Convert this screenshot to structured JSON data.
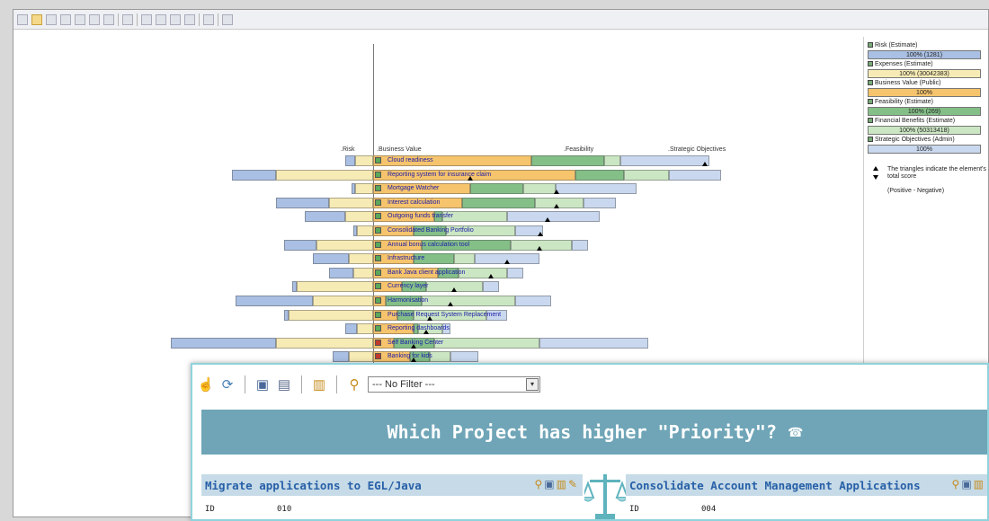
{
  "chart_columns": {
    "risk": ".Risk",
    "business_value": ".Business Value",
    "feasibility": ".Feasibility",
    "strategic": ".Strategic Objectives"
  },
  "colors": {
    "risk": "#a9bfe3",
    "expenses": "#f7ebb5",
    "business_value": "#f6c46c",
    "feasibility": "#84bf88",
    "financial_benefits": "#cbe6c3",
    "strategic": "#c9d8ee",
    "accent": "#6fa5b7"
  },
  "projects": [
    {
      "label": "Cloud readiness",
      "risk": 0.12,
      "expenses": 0.22,
      "value": 1.95,
      "feasibility": 0.9,
      "benefits": 0.2,
      "strategic": 1.1,
      "score": 4.1
    },
    {
      "label": "Reporting system for insurance claim",
      "risk": 0.55,
      "expenses": 1.2,
      "value": 2.5,
      "feasibility": 0.6,
      "benefits": 0.55,
      "strategic": 0.65,
      "score": 1.2
    },
    {
      "label": "Mortgage Watcher",
      "risk": 0.05,
      "expenses": 0.22,
      "value": 1.2,
      "feasibility": 0.65,
      "benefits": 0.4,
      "strategic": 1.0,
      "score": 2.27
    },
    {
      "label": "Interest calculation",
      "risk": 0.65,
      "expenses": 0.55,
      "value": 1.1,
      "feasibility": 0.9,
      "benefits": 0.6,
      "strategic": 0.4,
      "score": 2.27
    },
    {
      "label": "Outgoing funds transfer",
      "risk": 0.5,
      "expenses": 0.35,
      "value": 0.75,
      "feasibility": 0.1,
      "benefits": 0.8,
      "strategic": 1.15,
      "score": 2.16
    },
    {
      "label": "Consolidated Banking Portfolio",
      "risk": 0.05,
      "expenses": 0.2,
      "value": 0.5,
      "feasibility": 0.4,
      "benefits": 0.85,
      "strategic": 0.35,
      "score": 2.07
    },
    {
      "label": "Annual bonus calculation tool",
      "risk": 0.4,
      "expenses": 0.7,
      "value": 0.6,
      "feasibility": 1.1,
      "benefits": 0.75,
      "strategic": 0.2,
      "score": 2.05
    },
    {
      "label": "Infrastructure",
      "risk": 0.45,
      "expenses": 0.3,
      "value": 0.5,
      "feasibility": 0.5,
      "benefits": 0.25,
      "strategic": 0.8,
      "score": 1.65
    },
    {
      "label": "Bank Java client application",
      "risk": 0.3,
      "expenses": 0.25,
      "value": 0.8,
      "feasibility": 0.25,
      "benefits": 0.6,
      "strategic": 0.2,
      "score": 1.45
    },
    {
      "label": "Currency layer",
      "risk": 0.05,
      "expenses": 0.95,
      "value": 0.35,
      "feasibility": 0.3,
      "benefits": 0.7,
      "strategic": 0.2,
      "score": 1.0
    },
    {
      "label": "Harmonisation",
      "risk": 0.95,
      "expenses": 0.75,
      "value": 0.15,
      "feasibility": 0.45,
      "benefits": 1.15,
      "strategic": 0.45,
      "score": 0.95
    },
    {
      "label": "Purchase Request System Replacement",
      "risk": 0.05,
      "expenses": 1.05,
      "value": 0.3,
      "feasibility": 0.2,
      "benefits": 0.9,
      "strategic": 0.25,
      "score": 0.7
    },
    {
      "label": "Reporting dashboards",
      "risk": 0.15,
      "expenses": 0.2,
      "value": 0.5,
      "feasibility": 0.05,
      "benefits": 0.3,
      "strategic": 0.1,
      "score": 0.65
    },
    {
      "label": "Self Banking Center",
      "risk": 1.3,
      "expenses": 1.2,
      "value": 0.25,
      "feasibility": 0.5,
      "benefits": 1.3,
      "strategic": 1.35,
      "score": 0.5
    },
    {
      "label": "Banking for kids",
      "risk": 0.2,
      "expenses": 0.3,
      "value": 0.45,
      "feasibility": 0.25,
      "benefits": 0.25,
      "strategic": 0.35,
      "score": 0.5
    }
  ],
  "legend": {
    "items": [
      {
        "label": "Risk (Estimate)",
        "bar": "100% (1281)",
        "color": "#a9bfe3"
      },
      {
        "label": "Expenses (Estimate)",
        "bar": "100% (30042383)",
        "color": "#f7ebb5"
      },
      {
        "label": "Business Value (Public)",
        "bar": "100%",
        "color": "#f6c46c"
      },
      {
        "label": "Feasibility (Estimate)",
        "bar": "100% (269)",
        "color": "#84bf88"
      },
      {
        "label": "Financial Benefits (Estimate)",
        "bar": "100% (50313418)",
        "color": "#cbe6c3"
      },
      {
        "label": "Strategic Objectives (Admin)",
        "bar": "100%",
        "color": "#c9d8ee"
      }
    ],
    "note": "The triangles indicate the element's total score",
    "note2": "(Positive - Negative)"
  },
  "overlay": {
    "filter_value": "--- No Filter ---",
    "question": "Which Project has higher \"Priority\"?",
    "left_project": {
      "title": "Migrate applications to EGL/Java",
      "id_label": "ID",
      "id_value": "010"
    },
    "right_project": {
      "title": "Consolidate Account Management Applications",
      "id_label": "ID",
      "id_value": "004"
    }
  }
}
